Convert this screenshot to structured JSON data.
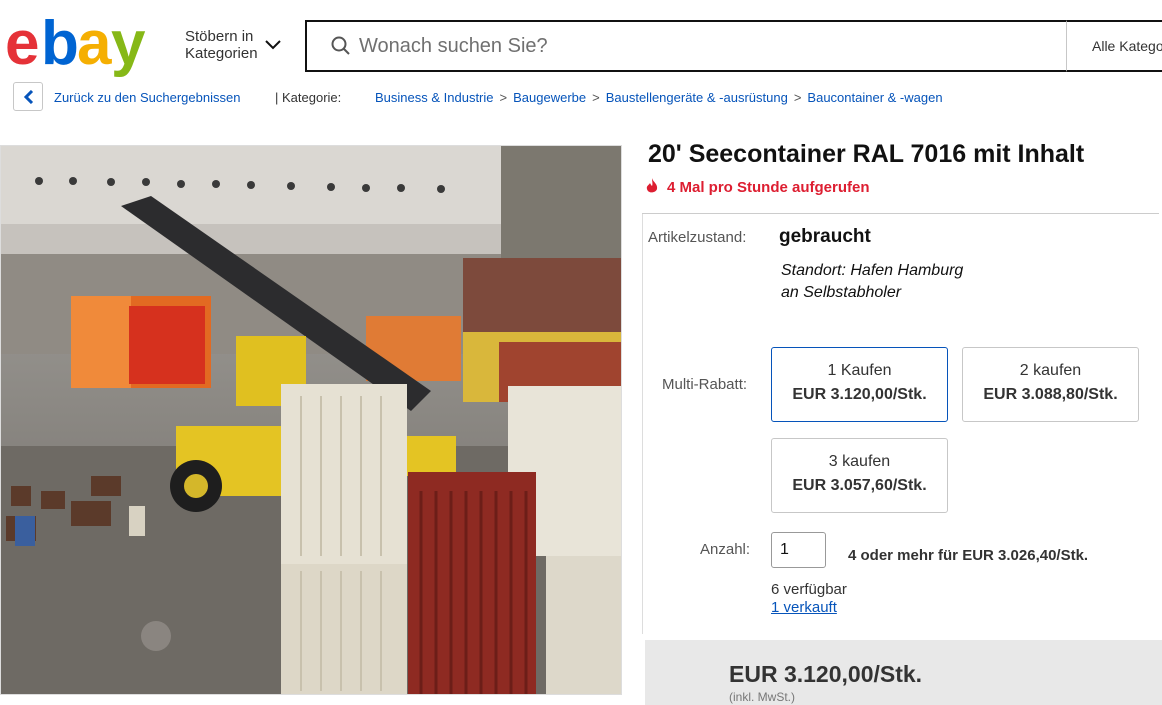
{
  "header": {
    "logo_text": "ebay",
    "browse_label_line1": "Stöbern in",
    "browse_label_line2": "Kategorien",
    "search_placeholder": "Wonach suchen Sie?",
    "category_select": "Alle Kategorien"
  },
  "breadcrumb": {
    "back_label": "Zurück zu den Suchergebnissen",
    "category_label": "| Kategorie:",
    "items": [
      "Business & Industrie",
      "Baugewerbe",
      "Baustellengeräte & -ausrüstung",
      "Baucontainer & -wagen"
    ],
    "separator": ">"
  },
  "listing": {
    "title": "20' Seecontainer RAL 7016 mit Inhalt",
    "views_text": "4 Mal pro Stunde aufgerufen",
    "condition_label": "Artikelzustand:",
    "condition_value": "gebraucht",
    "note_line1": "Standort: Hafen Hamburg",
    "note_line2": "an Selbstabholer",
    "multi_label": "Multi-Rabatt:",
    "tiles": [
      {
        "qty": "1 Kaufen",
        "price": "EUR 3.120,00/Stk."
      },
      {
        "qty": "2 kaufen",
        "price": "EUR 3.088,80/Stk."
      },
      {
        "qty": "3 kaufen",
        "price": "EUR 3.057,60/Stk."
      }
    ],
    "quantity_label": "Anzahl:",
    "quantity_value": "1",
    "bulk_text": "4 oder mehr für EUR 3.026,40/Stk.",
    "available": "6 verfügbar",
    "sold": "1 verkauft",
    "price": "EUR 3.120,00/Stk.",
    "vat": "(inkl. MwSt.)"
  },
  "colors": {
    "link": "#0654ba",
    "views_red": "#dd1e31",
    "logo_e": "#e53238",
    "logo_b": "#0064d2",
    "logo_a": "#f5af02",
    "logo_y": "#86b817"
  }
}
